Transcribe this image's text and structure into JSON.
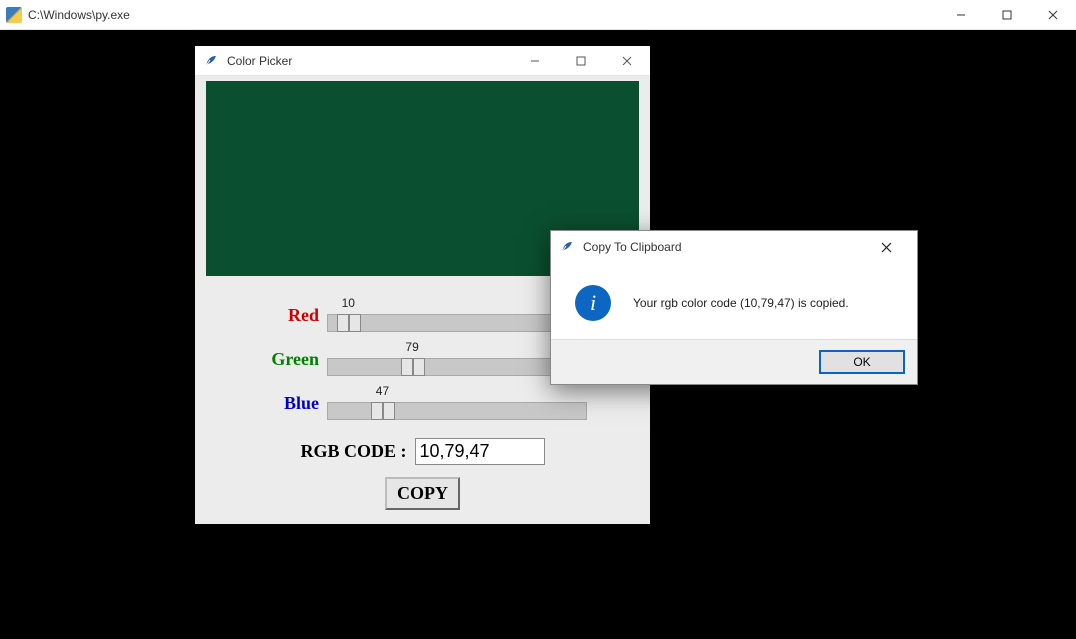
{
  "outer_window": {
    "title": "C:\\Windows\\py.exe"
  },
  "picker": {
    "title": "Color Picker",
    "preview_color": "rgb(10,79,47)",
    "sliders": {
      "red": {
        "label": "Red",
        "value": 10,
        "max": 255
      },
      "green": {
        "label": "Green",
        "value": 79,
        "max": 255
      },
      "blue": {
        "label": "Blue",
        "value": 47,
        "max": 255
      }
    },
    "rgb_code_label": "RGB CODE :",
    "rgb_code_value": "10,79,47",
    "copy_button": "COPY"
  },
  "msgbox": {
    "title": "Copy To Clipboard",
    "message": "Your rgb color code (10,79,47) is copied.",
    "ok_button": "OK"
  }
}
